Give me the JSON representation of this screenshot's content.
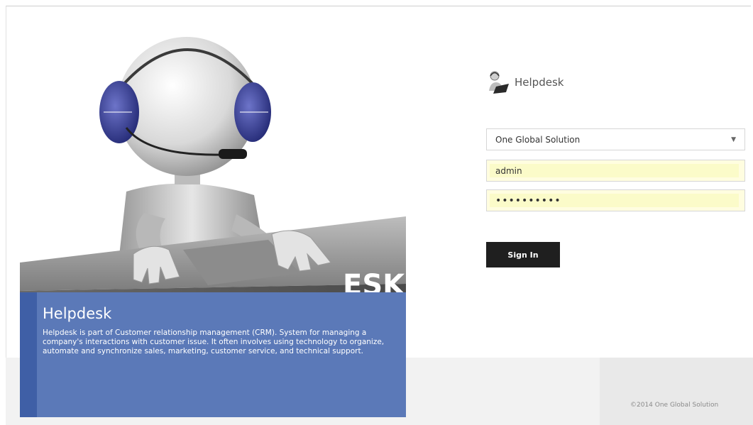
{
  "hero": {
    "title": "Helpdesk",
    "description": "Helpdesk is part of Customer relationship management (CRM). System for managing a company's interactions with customer issue. It often involves using technology to organize, automate and synchronize sales, marketing, customer service, and technical support.",
    "desk_sign_text": "ESK"
  },
  "login": {
    "brand_name": "Helpdesk",
    "company_select": {
      "selected": "One Global Solution"
    },
    "username": {
      "value": "admin"
    },
    "password": {
      "masked_value": "••••••••••"
    },
    "signin_label": "Sign In"
  },
  "footer": {
    "copyright": "©2014 One Global Solution"
  },
  "colors": {
    "info_panel": "#5b79b8",
    "info_accent": "#3f5fa6",
    "button": "#1f1f1f",
    "autofill": "#fffde0",
    "headphone": "#2e3590"
  }
}
